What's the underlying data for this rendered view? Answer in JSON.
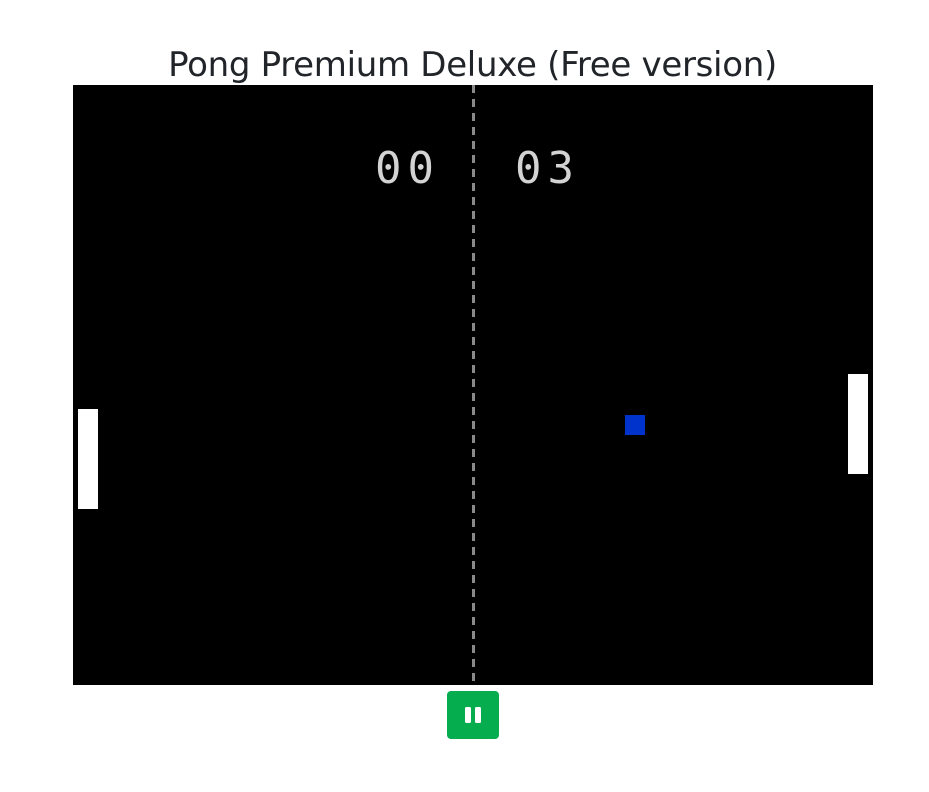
{
  "page": {
    "title": "Pong Premium Deluxe (Free version)"
  },
  "scoreboard": {
    "left_score": "00",
    "right_score": "03"
  },
  "ball": {
    "color": "#0033cc"
  },
  "controls": {
    "pause_icon": "pause-icon",
    "pause_button_color": "#05ad4f"
  },
  "colors": {
    "board": "#000000",
    "paddle": "#ffffff",
    "score_text": "#d3d3d3",
    "center_line": "#8a8a8a"
  }
}
